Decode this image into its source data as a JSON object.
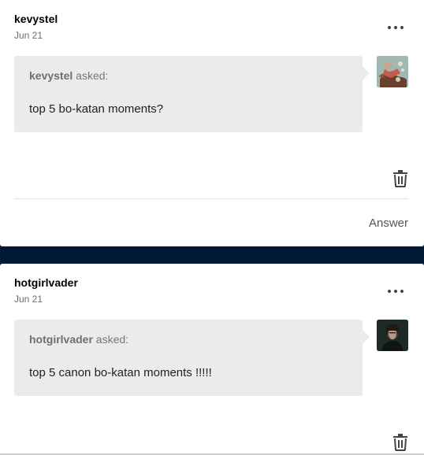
{
  "posts": [
    {
      "username": "kevystel",
      "date": "Jun 21",
      "asker": "kevystel",
      "asked_label": "asked:",
      "question": "top 5 bo-katan moments?",
      "answer_label": "Answer"
    },
    {
      "username": "hotgirlvader",
      "date": "Jun 21",
      "asker": "hotgirlvader",
      "asked_label": "asked:",
      "question": "top 5 canon bo-katan moments !!!!!"
    }
  ],
  "colors": {
    "background": "#001935",
    "card": "#ffffff",
    "bubble": "#ebebeb"
  },
  "icons": [
    "more-options-icon",
    "trash-icon",
    "avatar-image"
  ]
}
